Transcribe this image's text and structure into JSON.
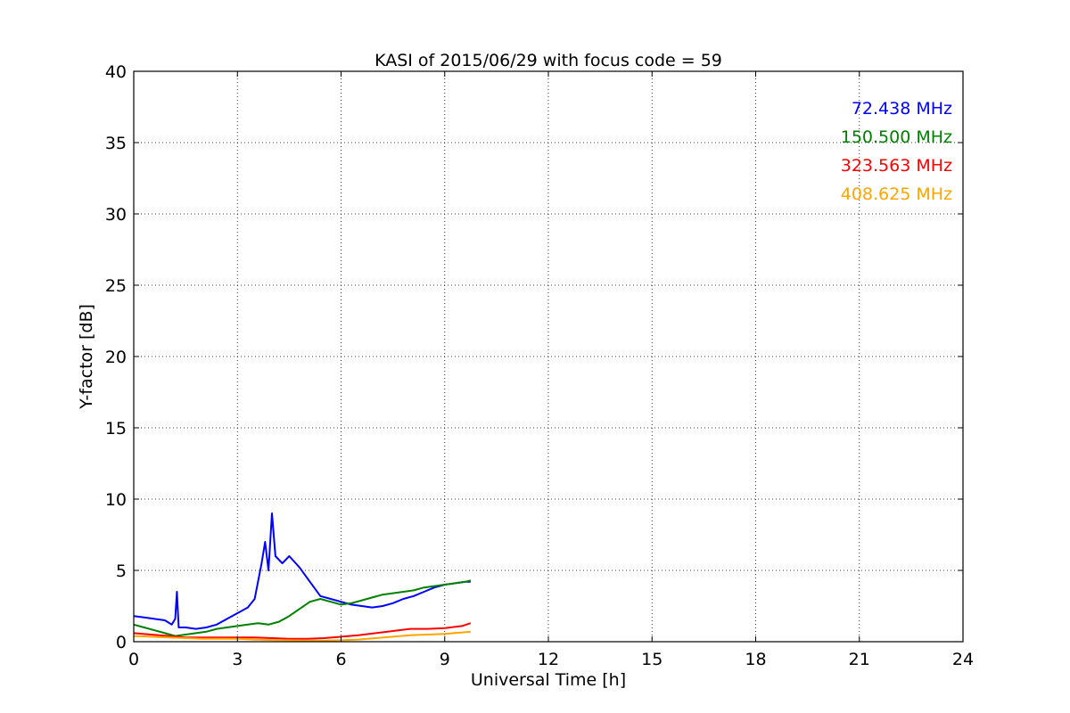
{
  "chart_data": {
    "type": "line",
    "title": "KASI of 2015/06/29 with focus code = 59",
    "xlabel": "Universal Time [h]",
    "ylabel": "Y-factor [dB]",
    "xlim": [
      0,
      24
    ],
    "ylim": [
      0,
      40
    ],
    "xticks": [
      0,
      3,
      6,
      9,
      12,
      15,
      18,
      21,
      24
    ],
    "yticks": [
      0,
      5,
      10,
      15,
      20,
      25,
      30,
      35,
      40
    ],
    "grid": true,
    "legend_position": "top-right",
    "series": [
      {
        "name": "72.438 MHz",
        "color": "#0000ff",
        "x": [
          0.0,
          0.3,
          0.6,
          0.9,
          1.1,
          1.2,
          1.25,
          1.3,
          1.5,
          1.8,
          2.1,
          2.4,
          2.7,
          3.0,
          3.3,
          3.5,
          3.7,
          3.8,
          3.9,
          4.0,
          4.1,
          4.3,
          4.5,
          4.8,
          5.1,
          5.4,
          5.7,
          6.0,
          6.3,
          6.6,
          6.9,
          7.2,
          7.5,
          7.8,
          8.1,
          8.4,
          8.7,
          9.0,
          9.3,
          9.6,
          9.75
        ],
        "y": [
          1.8,
          1.7,
          1.6,
          1.5,
          1.2,
          1.6,
          3.5,
          1.0,
          1.0,
          0.9,
          1.0,
          1.2,
          1.6,
          2.0,
          2.4,
          3.0,
          5.5,
          7.0,
          5.0,
          9.0,
          6.0,
          5.5,
          6.0,
          5.2,
          4.2,
          3.2,
          3.0,
          2.8,
          2.6,
          2.5,
          2.4,
          2.5,
          2.7,
          3.0,
          3.2,
          3.5,
          3.8,
          4.0,
          4.1,
          4.2,
          4.2
        ]
      },
      {
        "name": "150.500 MHz",
        "color": "#008000",
        "x": [
          0.0,
          0.3,
          0.6,
          0.9,
          1.2,
          1.5,
          1.8,
          2.1,
          2.4,
          2.7,
          3.0,
          3.3,
          3.6,
          3.9,
          4.2,
          4.5,
          4.8,
          5.1,
          5.4,
          5.7,
          6.0,
          6.3,
          6.6,
          6.9,
          7.2,
          7.5,
          7.8,
          8.1,
          8.4,
          8.7,
          9.0,
          9.3,
          9.6,
          9.75
        ],
        "y": [
          1.2,
          1.0,
          0.8,
          0.6,
          0.4,
          0.5,
          0.6,
          0.7,
          0.9,
          1.0,
          1.1,
          1.2,
          1.3,
          1.2,
          1.4,
          1.8,
          2.3,
          2.8,
          3.0,
          2.8,
          2.6,
          2.7,
          2.9,
          3.1,
          3.3,
          3.4,
          3.5,
          3.6,
          3.8,
          3.9,
          4.0,
          4.1,
          4.2,
          4.3
        ]
      },
      {
        "name": "323.563 MHz",
        "color": "#ff0000",
        "x": [
          0.0,
          0.5,
          1.0,
          1.5,
          2.0,
          2.5,
          3.0,
          3.5,
          4.0,
          4.5,
          5.0,
          5.5,
          6.0,
          6.5,
          7.0,
          7.5,
          8.0,
          8.5,
          9.0,
          9.5,
          9.75
        ],
        "y": [
          0.6,
          0.5,
          0.4,
          0.3,
          0.3,
          0.3,
          0.3,
          0.3,
          0.25,
          0.2,
          0.2,
          0.25,
          0.35,
          0.45,
          0.6,
          0.75,
          0.9,
          0.9,
          0.95,
          1.1,
          1.3
        ]
      },
      {
        "name": "408.625 MHz",
        "color": "#ffa500",
        "x": [
          0.0,
          0.5,
          1.0,
          1.5,
          2.0,
          2.5,
          3.0,
          3.5,
          4.0,
          4.5,
          5.0,
          5.5,
          6.0,
          6.5,
          7.0,
          7.5,
          8.0,
          8.5,
          9.0,
          9.5,
          9.75
        ],
        "y": [
          0.4,
          0.35,
          0.3,
          0.25,
          0.2,
          0.2,
          0.2,
          0.15,
          0.12,
          0.1,
          0.08,
          0.08,
          0.1,
          0.15,
          0.25,
          0.35,
          0.45,
          0.5,
          0.55,
          0.65,
          0.7
        ]
      }
    ]
  }
}
